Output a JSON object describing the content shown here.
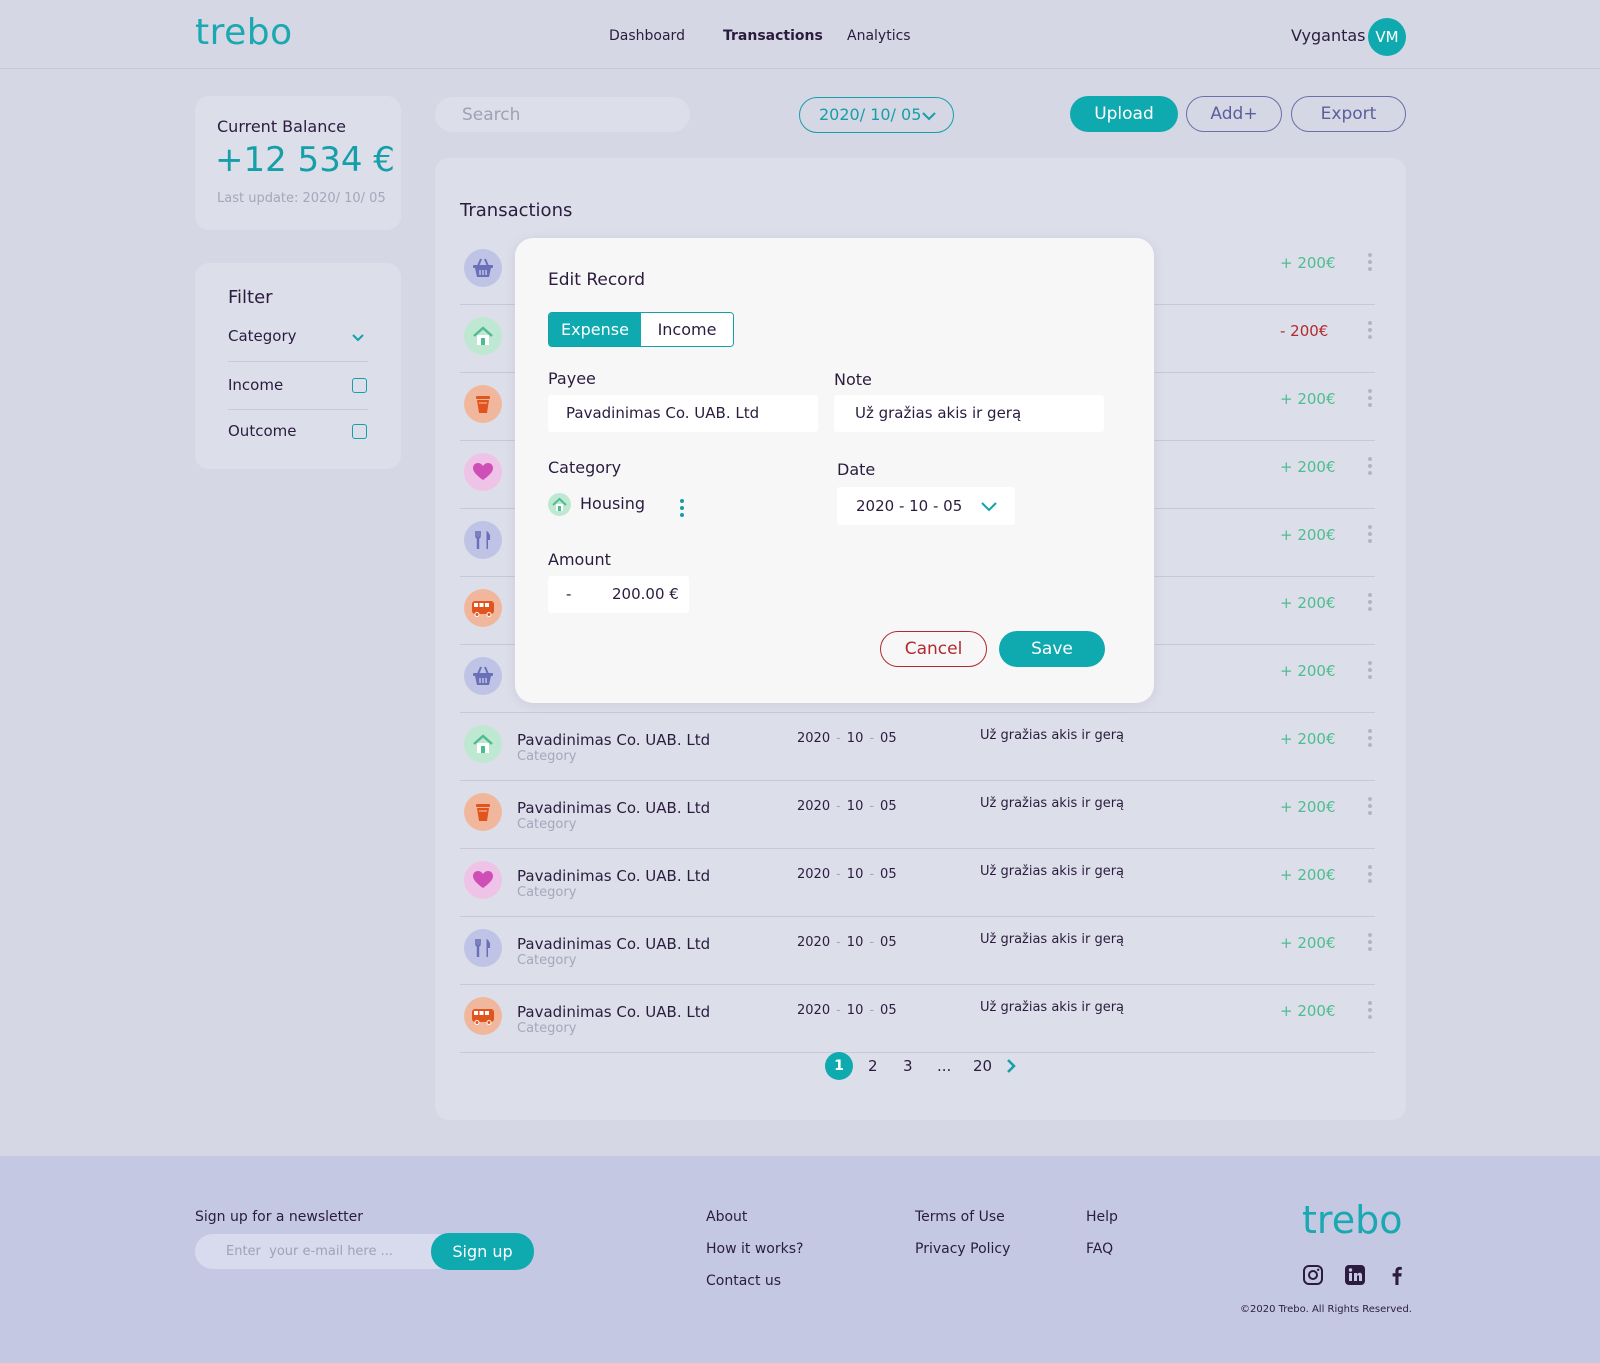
{
  "header": {
    "logo": "trebo",
    "nav": [
      "Dashboard",
      "Transactions",
      "Analytics"
    ],
    "active_nav": "Transactions",
    "user_name": "Vygantas",
    "user_initials": "VM"
  },
  "balance": {
    "title": "Current Balance",
    "value": "+12 534 €",
    "last_update": "Last update: 2020/ 10/ 05"
  },
  "filter": {
    "title": "Filter",
    "category_label": "Category",
    "income_label": "Income",
    "outcome_label": "Outcome",
    "income_checked": false,
    "outcome_checked": false
  },
  "toolbar": {
    "search_placeholder": "Search",
    "date": "2020/ 10/ 05",
    "upload_label": "Upload",
    "add_label": "Add+",
    "export_label": "Export"
  },
  "transactions": {
    "title": "Transactions",
    "rows": [
      {
        "icon": "basket-icon",
        "payee": "",
        "category": "",
        "date": [
          "",
          "",
          ""
        ],
        "note": "",
        "amount": "+ 200€",
        "positive": true
      },
      {
        "icon": "house-icon",
        "payee": "",
        "category": "",
        "date": [
          "",
          "",
          ""
        ],
        "note": "",
        "amount": "- 200€",
        "positive": false
      },
      {
        "icon": "cup-icon",
        "payee": "",
        "category": "",
        "date": [
          "",
          "",
          ""
        ],
        "note": "",
        "amount": "+ 200€",
        "positive": true
      },
      {
        "icon": "heart-icon",
        "payee": "",
        "category": "",
        "date": [
          "",
          "",
          ""
        ],
        "note": "",
        "amount": "+ 200€",
        "positive": true
      },
      {
        "icon": "cutlery-icon",
        "payee": "",
        "category": "",
        "date": [
          "",
          "",
          ""
        ],
        "note": "",
        "amount": "+ 200€",
        "positive": true
      },
      {
        "icon": "bus-icon",
        "payee": "",
        "category": "",
        "date": [
          "",
          "",
          ""
        ],
        "note": "",
        "amount": "+ 200€",
        "positive": true
      },
      {
        "icon": "basket-icon",
        "payee": "",
        "category": "",
        "date": [
          "",
          "",
          ""
        ],
        "note": "",
        "amount": "+ 200€",
        "positive": true
      },
      {
        "icon": "house-icon",
        "payee": "Pavadinimas Co. UAB. Ltd",
        "category": "Category",
        "date": [
          "2020",
          "10",
          "05"
        ],
        "note": "Už gražias akis ir gerą",
        "amount": "+ 200€",
        "positive": true
      },
      {
        "icon": "cup-icon",
        "payee": "Pavadinimas Co. UAB. Ltd",
        "category": "Category",
        "date": [
          "2020",
          "10",
          "05"
        ],
        "note": "Už gražias akis ir gerą",
        "amount": "+ 200€",
        "positive": true
      },
      {
        "icon": "heart-icon",
        "payee": "Pavadinimas Co. UAB. Ltd",
        "category": "Category",
        "date": [
          "2020",
          "10",
          "05"
        ],
        "note": "Už gražias akis ir gerą",
        "amount": "+ 200€",
        "positive": true
      },
      {
        "icon": "cutlery-icon",
        "payee": "Pavadinimas Co. UAB. Ltd",
        "category": "Category",
        "date": [
          "2020",
          "10",
          "05"
        ],
        "note": "Už gražias akis ir gerą",
        "amount": "+ 200€",
        "positive": true
      },
      {
        "icon": "bus-icon",
        "payee": "Pavadinimas Co. UAB. Ltd",
        "category": "Category",
        "date": [
          "2020",
          "10",
          "05"
        ],
        "note": "Už gražias akis ir gerą",
        "amount": "+ 200€",
        "positive": true
      }
    ]
  },
  "pagination": {
    "current": "1",
    "pages": [
      "2",
      "3",
      "...",
      "20"
    ]
  },
  "modal": {
    "title": "Edit Record",
    "expense_label": "Expense",
    "income_label": "Income",
    "payee_label": "Payee",
    "payee_value": "Pavadinimas Co. UAB. Ltd",
    "note_label": "Note",
    "note_value": "Už gražias akis ir gerą",
    "category_label": "Category",
    "category_value": "Housing",
    "date_label": "Date",
    "date_value": "2020 - 10 - 05",
    "amount_label": "Amount",
    "amount_sign": "-",
    "amount_value": "200.00 €",
    "cancel_label": "Cancel",
    "save_label": "Save"
  },
  "footer": {
    "newsletter_label": "Sign up for a newsletter",
    "email_placeholder": "Enter  your e-mail here ...",
    "signup_label": "Sign up",
    "links_col1": [
      "About",
      "How it works?",
      "Contact us"
    ],
    "links_col2": [
      "Terms of Use",
      "Privacy Policy"
    ],
    "links_col3": [
      "Help",
      "FAQ"
    ],
    "logo": "trebo",
    "social": [
      "instagram-icon",
      "linkedin-icon",
      "facebook-icon"
    ],
    "copyright": "©2020 Trebo. All Rights Reserved."
  },
  "colors": {
    "accent": "#0fa9b0",
    "positive": "#4dbd8f",
    "negative": "#b02a30",
    "text": "#2b1c3f",
    "background": "#d5d7e4",
    "footer": "#c4c8e3"
  }
}
